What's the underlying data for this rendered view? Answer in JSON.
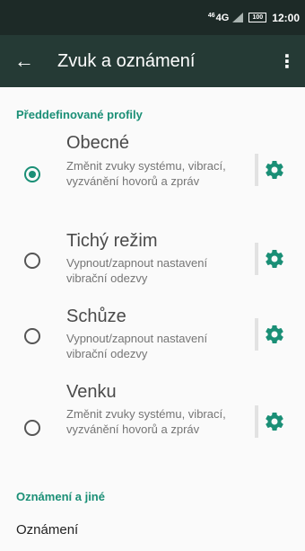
{
  "status_bar": {
    "network": "4G",
    "network_prefix": "46",
    "battery": "100",
    "time": "12:00"
  },
  "app_bar": {
    "title": "Zvuk a oznámení",
    "back_icon": "←",
    "menu_icon": "⋮"
  },
  "sections": {
    "predefined": "Předdefinované profily",
    "notifications": "Oznámení a jiné"
  },
  "profiles": [
    {
      "name": "Obecné",
      "description": "Změnit zvuky systému, vibrací, vyzvánění hovorů a zpráv",
      "selected": true
    },
    {
      "name": "Tichý režim",
      "description": "Vypnout/zapnout nastavení vibrační odezvy",
      "selected": false
    },
    {
      "name": "Schůze",
      "description": "Vypnout/zapnout nastavení vibrační odezvy",
      "selected": false
    },
    {
      "name": "Venku",
      "description": "Změnit zvuky systému, vibrací, vyzvánění hovorů a zpráv",
      "selected": false
    }
  ],
  "notification_item": "Oznámení",
  "colors": {
    "accent": "#1a8f76",
    "toolbar": "#253a35",
    "statusbar": "#1d2a27"
  }
}
